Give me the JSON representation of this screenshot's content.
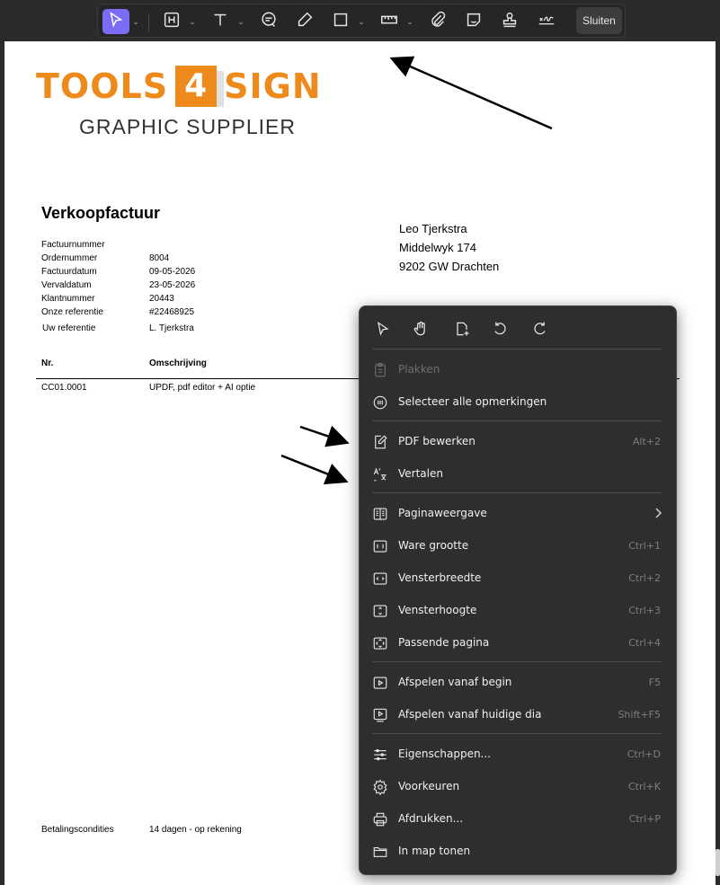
{
  "toolbar": {
    "tools": [
      {
        "name": "select-icon"
      },
      {
        "name": "highlight-icon"
      },
      {
        "name": "text-icon"
      },
      {
        "name": "comment-icon"
      },
      {
        "name": "pencil-icon"
      },
      {
        "name": "rectangle-icon"
      },
      {
        "name": "measure-icon"
      },
      {
        "name": "attachment-icon"
      },
      {
        "name": "sticker-icon"
      },
      {
        "name": "stamp-icon"
      },
      {
        "name": "signature-icon"
      }
    ],
    "close_label": "Sluiten",
    "accent": "#7b6cf6"
  },
  "document": {
    "logo": {
      "left": "TOOLS",
      "box": "4",
      "right": "SIGN",
      "sub": "GRAPHIC  SUPPLIER",
      "color": "#ee8a1c"
    },
    "title": "Verkoopfactuur",
    "meta": [
      {
        "label": "Factuurnummer",
        "value": ""
      },
      {
        "label": "Ordernummer",
        "value": "8004"
      },
      {
        "label": "Factuurdatum",
        "value": "09-05-2026"
      },
      {
        "label": "Vervaldatum",
        "value": "23-05-2026"
      },
      {
        "label": "Klantnummer",
        "value": "20443"
      },
      {
        "label": "Onze referentie",
        "value": "#22468925"
      },
      {
        "label": "Uw referentie",
        "value": "L. Tjerkstra"
      }
    ],
    "address": [
      "Leo Tjerkstra",
      "Middelwyk 174",
      "9202 GW  Drachten"
    ],
    "table": {
      "headers": [
        "Nr.",
        "Omschrijving"
      ],
      "rows": [
        [
          "CC01.0001",
          "UPDF, pdf editor + AI optie"
        ]
      ]
    },
    "footer": {
      "label": "Betalingscondities",
      "value": "14 dagen - op rekening"
    }
  },
  "context_menu": {
    "top_icons": [
      "pointer-icon",
      "hand-icon",
      "add-page-icon",
      "rotate-left-icon",
      "rotate-right-icon"
    ],
    "items": [
      {
        "label": "Plakken",
        "shortcut": "",
        "icon": "paste-icon",
        "disabled": true
      },
      {
        "label": "Selecteer alle opmerkingen",
        "shortcut": "",
        "icon": "select-comments-icon"
      },
      {
        "label": "PDF bewerken",
        "shortcut": "Alt+2",
        "icon": "edit-pdf-icon"
      },
      {
        "label": "Vertalen",
        "shortcut": "",
        "icon": "translate-icon"
      },
      {
        "label": "Paginaweergave",
        "shortcut": "",
        "icon": "page-view-icon",
        "submenu": true
      },
      {
        "label": "Ware grootte",
        "shortcut": "Ctrl+1",
        "icon": "actual-size-icon"
      },
      {
        "label": "Vensterbreedte",
        "shortcut": "Ctrl+2",
        "icon": "fit-width-icon"
      },
      {
        "label": "Vensterhoogte",
        "shortcut": "Ctrl+3",
        "icon": "fit-height-icon"
      },
      {
        "label": "Passende pagina",
        "shortcut": "Ctrl+4",
        "icon": "fit-page-icon"
      },
      {
        "label": "Afspelen vanaf begin",
        "shortcut": "F5",
        "icon": "play-start-icon"
      },
      {
        "label": "Afspelen vanaf huidige dia",
        "shortcut": "Shift+F5",
        "icon": "play-current-icon"
      },
      {
        "label": "Eigenschappen...",
        "shortcut": "Ctrl+D",
        "icon": "properties-icon"
      },
      {
        "label": "Voorkeuren",
        "shortcut": "Ctrl+K",
        "icon": "gear-icon"
      },
      {
        "label": "Afdrukken...",
        "shortcut": "Ctrl+P",
        "icon": "print-icon"
      },
      {
        "label": "In map tonen",
        "shortcut": "",
        "icon": "folder-icon"
      }
    ]
  }
}
